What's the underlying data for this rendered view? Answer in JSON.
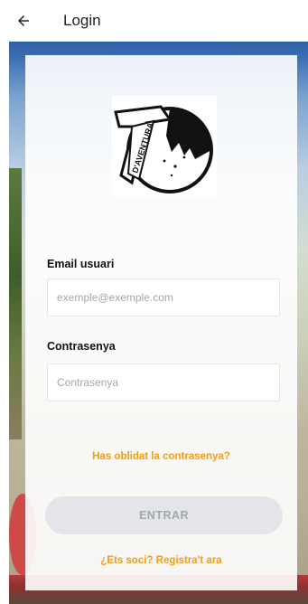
{
  "appbar": {
    "back_icon": "arrow-left-icon",
    "title": "Login"
  },
  "logo": {
    "text": "D'AVENTURA"
  },
  "form": {
    "email_label": "Email usuari",
    "email_placeholder": "exemple@exemple.com",
    "email_value": "",
    "password_label": "Contrasenya",
    "password_placeholder": "Contrasenya",
    "password_value": "",
    "forgot_link": "Has oblidat la contrasenya?",
    "submit_label": "ENTRAR",
    "register_link": "¿Ets soci? Registra't ara"
  },
  "colors": {
    "accent": "#f39c12",
    "button_disabled_bg": "#e3e5e8",
    "button_disabled_text": "#a2a6ab"
  }
}
